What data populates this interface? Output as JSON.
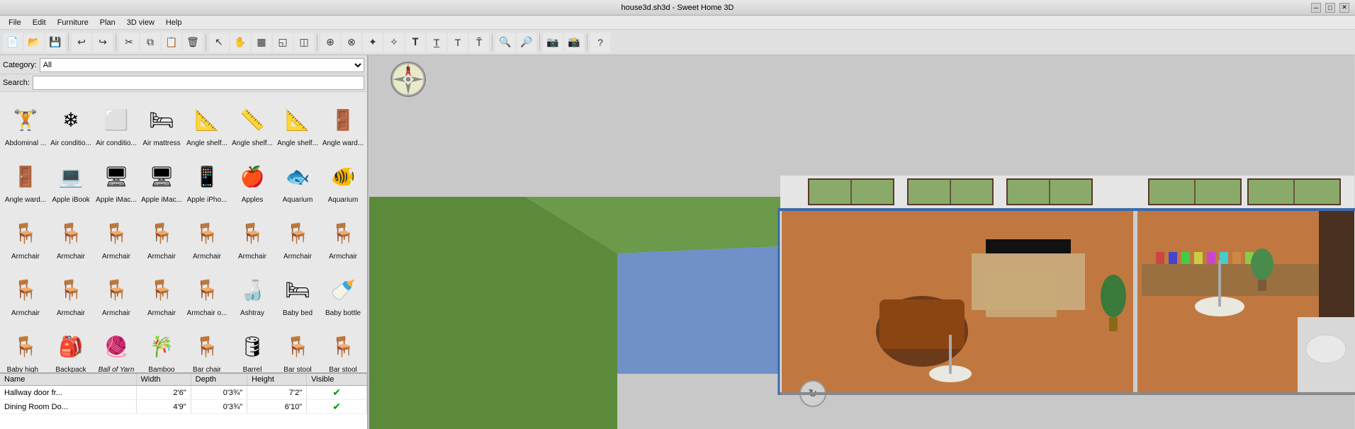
{
  "titlebar": {
    "title": "house3d.sh3d - Sweet Home 3D",
    "minimize": "─",
    "maximize": "□",
    "close": "✕"
  },
  "menubar": {
    "items": [
      "File",
      "Edit",
      "Furniture",
      "Plan",
      "3D view",
      "Help"
    ]
  },
  "toolbar": {
    "buttons": [
      {
        "name": "new",
        "icon": "📄"
      },
      {
        "name": "open",
        "icon": "📂"
      },
      {
        "name": "save",
        "icon": "💾"
      },
      {
        "name": "sep1",
        "icon": ""
      },
      {
        "name": "undo",
        "icon": "↩"
      },
      {
        "name": "redo",
        "icon": "↪"
      },
      {
        "name": "sep2",
        "icon": ""
      },
      {
        "name": "cut",
        "icon": "✂"
      },
      {
        "name": "copy",
        "icon": "⧉"
      },
      {
        "name": "paste",
        "icon": "📋"
      },
      {
        "name": "delete",
        "icon": "🗑"
      },
      {
        "name": "sep3",
        "icon": ""
      },
      {
        "name": "select",
        "icon": "↖"
      },
      {
        "name": "pan",
        "icon": "✋"
      },
      {
        "name": "create-wall",
        "icon": "▦"
      },
      {
        "name": "create-room",
        "icon": "◱"
      },
      {
        "name": "sep4",
        "icon": ""
      },
      {
        "name": "zoom-in",
        "icon": "🔍"
      },
      {
        "name": "zoom-out",
        "icon": "🔎"
      },
      {
        "name": "sep5",
        "icon": ""
      },
      {
        "name": "help",
        "icon": "?"
      }
    ]
  },
  "leftpanel": {
    "category_label": "Category:",
    "category_value": "All",
    "search_label": "Search:",
    "search_placeholder": ""
  },
  "furniture": [
    {
      "label": "Abdominal ...",
      "icon": "🏋",
      "italic": false
    },
    {
      "label": "Air conditio...",
      "icon": "❄",
      "italic": false
    },
    {
      "label": "Air conditio...",
      "icon": "⬜",
      "italic": false
    },
    {
      "label": "Air mattress",
      "icon": "🛏",
      "italic": false
    },
    {
      "label": "Angle shelf...",
      "icon": "📐",
      "italic": false
    },
    {
      "label": "Angle shelf...",
      "icon": "📏",
      "italic": false
    },
    {
      "label": "Angle shelf...",
      "icon": "📐",
      "italic": false
    },
    {
      "label": "Angle ward...",
      "icon": "🚪",
      "italic": false
    },
    {
      "label": "Angle ward...",
      "icon": "🚪",
      "italic": false
    },
    {
      "label": "Apple iBook",
      "icon": "💻",
      "italic": false
    },
    {
      "label": "Apple iMac...",
      "icon": "🖥",
      "italic": false
    },
    {
      "label": "Apple iMac...",
      "icon": "🖥",
      "italic": false
    },
    {
      "label": "Apple iPho...",
      "icon": "📱",
      "italic": false
    },
    {
      "label": "Apples",
      "icon": "🍎",
      "italic": false
    },
    {
      "label": "Aquarium",
      "icon": "🐟",
      "italic": false
    },
    {
      "label": "Aquarium",
      "icon": "🐠",
      "italic": false
    },
    {
      "label": "Armchair",
      "icon": "🪑",
      "italic": false
    },
    {
      "label": "Armchair",
      "icon": "🪑",
      "italic": false
    },
    {
      "label": "Armchair",
      "icon": "🪑",
      "italic": false
    },
    {
      "label": "Armchair",
      "icon": "🪑",
      "italic": false
    },
    {
      "label": "Armchair",
      "icon": "🪑",
      "italic": false
    },
    {
      "label": "Armchair",
      "icon": "🪑",
      "italic": false
    },
    {
      "label": "Armchair",
      "icon": "🪑",
      "italic": false
    },
    {
      "label": "Armchair",
      "icon": "🪑",
      "italic": false
    },
    {
      "label": "Armchair",
      "icon": "🪑",
      "italic": false
    },
    {
      "label": "Armchair",
      "icon": "🪑",
      "italic": false
    },
    {
      "label": "Armchair",
      "icon": "🪑",
      "italic": false
    },
    {
      "label": "Armchair",
      "icon": "🪑",
      "italic": false
    },
    {
      "label": "Armchair o...",
      "icon": "🪑",
      "italic": false
    },
    {
      "label": "Ashtray",
      "icon": "🍶",
      "italic": false
    },
    {
      "label": "Baby bed",
      "icon": "🛏",
      "italic": false
    },
    {
      "label": "Baby bottle",
      "icon": "🍼",
      "italic": false
    },
    {
      "label": "Baby high _",
      "icon": "🪑",
      "italic": false
    },
    {
      "label": "Backpack",
      "icon": "🎒",
      "italic": false
    },
    {
      "label": "Ball of Yarn",
      "icon": "🧶",
      "italic": true
    },
    {
      "label": "Bamboo",
      "icon": "🎋",
      "italic": false
    },
    {
      "label": "Bar chair",
      "icon": "🪑",
      "italic": false
    },
    {
      "label": "Barrel",
      "icon": "🛢",
      "italic": false
    },
    {
      "label": "Bar stool",
      "icon": "🪑",
      "italic": false
    },
    {
      "label": "Bar stool",
      "icon": "🪑",
      "italic": false
    }
  ],
  "table": {
    "headers": [
      "Name",
      "Width",
      "Depth",
      "Height",
      "Visible"
    ],
    "rows": [
      {
        "name": "Hallway door fr...",
        "width": "2'6\"",
        "depth": "0'3¾\"",
        "height": "7'2\"",
        "visible": true
      },
      {
        "name": "Dining Room Do...",
        "width": "4'9\"",
        "depth": "0'3¾\"",
        "height": "6'10\"",
        "visible": true
      }
    ]
  },
  "compass": {
    "symbol": "⊕"
  }
}
